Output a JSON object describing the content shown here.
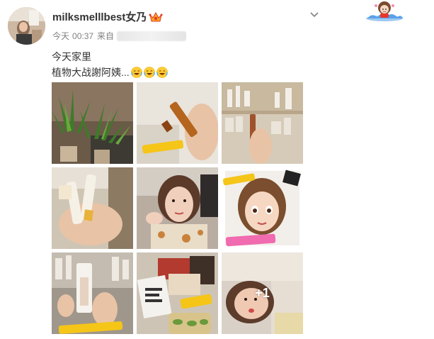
{
  "post": {
    "username": "milksmelllbest女乃",
    "time_prefix": "今天",
    "time": "00:37",
    "from_label": "来自",
    "text_line1": "今天家里",
    "text_line2": "植物大战謝阿姨...",
    "emoji_count": 3,
    "more_images_label": "+1"
  },
  "icons": {
    "avatar": "avatar-photo",
    "vip": "vip-crown-icon",
    "menu": "chevron-down-icon",
    "sticker": "cartoon-girl-sticker",
    "emoji": "laughing-tears-emoji"
  },
  "colors": {
    "text": "#333333",
    "meta": "#808080",
    "vip_orange": "#f5a623",
    "vip_red": "#e8372b",
    "sticker_blue": "#5aa0e8"
  },
  "images": [
    {
      "name": "plants-photo"
    },
    {
      "name": "ampoule-hand-photo"
    },
    {
      "name": "cosmetics-shelf-photo"
    },
    {
      "name": "tube-products-photo"
    },
    {
      "name": "selfie-photo"
    },
    {
      "name": "cartoon-avatar-photo"
    },
    {
      "name": "skincare-bottles-photo"
    },
    {
      "name": "snack-boxes-photo"
    },
    {
      "name": "lying-selfie-photo"
    }
  ]
}
